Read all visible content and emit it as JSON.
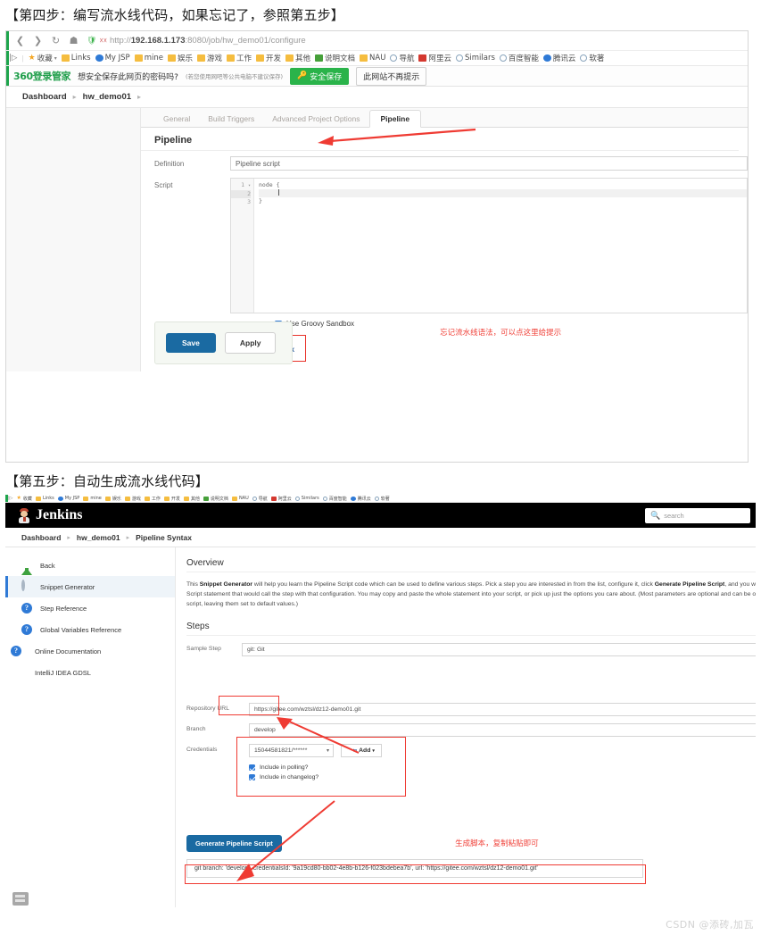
{
  "steps": {
    "step4_heading": "【第四步：编写流水线代码，如果忘记了，参照第五步】",
    "step5_heading": "【第五步：自动生成流水线代码】"
  },
  "browser": {
    "back_icon": "chevron-left-icon",
    "forward_icon": "chevron-right-icon",
    "reload_icon": "reload-icon",
    "home_icon": "home-icon",
    "url_host": "192.168.1.173",
    "url_rest": "http://192.168.1.173:8080/job/hw_demo01/configure",
    "url_prefix": "http://",
    "url_suffix": ":8080/job/hw_demo01/configure",
    "bookmarks": [
      "收藏",
      "Links",
      "My JSP",
      "mine",
      "娱乐",
      "游戏",
      "工作",
      "开发",
      "其他",
      "说明文档",
      "NAU",
      "导航",
      "阿里云",
      "Similars",
      "百度智能",
      "腾讯云",
      "软著"
    ],
    "password_bar": {
      "brand": "360登录管家",
      "question": "想安全保存此网页的密码吗?",
      "hint": "(若您使用网吧等公共电脑不建议保存)",
      "save_label": "安全保存",
      "never_label": "此网站不再提示",
      "key_icon": "key-icon"
    }
  },
  "configure": {
    "breadcrumb": [
      "Dashboard",
      "hw_demo01"
    ],
    "tabs": [
      "General",
      "Build Triggers",
      "Advanced Project Options",
      "Pipeline"
    ],
    "active_tab": "Pipeline",
    "section_title": "Pipeline",
    "definition_label": "Definition",
    "definition_value": "Pipeline script",
    "script_label": "Script",
    "code_lines": [
      "node {",
      "",
      "}"
    ],
    "line_numbers": [
      "1",
      "2",
      "3"
    ],
    "fold_marker": "▾",
    "sandbox_label": "Use Groovy Sandbox",
    "sandbox_checked": true,
    "pipeline_syntax_link": "Pipeline Syntax",
    "annotation": "忘记流水线语法，可以点这里给提示",
    "save_label": "Save",
    "apply_label": "Apply"
  },
  "snippet": {
    "logo_text": "Jenkins",
    "search_placeholder": "search",
    "search_icon": "search-icon",
    "breadcrumb": [
      "Dashboard",
      "hw_demo01",
      "Pipeline Syntax"
    ],
    "sidebar": [
      {
        "label": "Back",
        "icon": "up-arrow-icon"
      },
      {
        "label": "Snippet Generator",
        "icon": "gear-icon"
      },
      {
        "label": "Step Reference",
        "icon": "help-icon"
      },
      {
        "label": "Global Variables Reference",
        "icon": "help-icon"
      },
      {
        "label": "Online Documentation",
        "icon": "help-icon"
      },
      {
        "label": "IntelliJ IDEA GDSL",
        "icon": "package-icon"
      }
    ],
    "active_sidebar": "Snippet Generator",
    "overview_title": "Overview",
    "overview_text_1": "This ",
    "overview_bold_1": "Snippet Generator",
    "overview_text_2": " will help you learn the Pipeline Script code which can be used to define various steps. Pick a step you are interested in from the list, configure it, click ",
    "overview_bold_2": "Generate Pipeline Script",
    "overview_text_3": ", and you will see a Pipeline Script statement that would call the step with that configuration. You may copy and paste the whole statement into your script, or pick up just the options you care about. (Most parameters are optional and can be omitted in your script, leaving them set to default values.)",
    "steps_title": "Steps",
    "sample_step_label": "Sample Step",
    "sample_step_value": "git: Git",
    "repo_url_label": "Repository URL",
    "repo_url_value": "https://gitee.com/wztsl/dz12-demo01.git",
    "branch_label": "Branch",
    "branch_value": "develop",
    "credentials_label": "Credentials",
    "credentials_value": "15044581821/******",
    "add_button_label": "Add",
    "add_icon": "key-add-icon",
    "polling_label": "Include in polling?",
    "polling_checked": true,
    "changelog_label": "Include in changelog?",
    "changelog_checked": true,
    "generate_button": "Generate Pipeline Script",
    "generated_script": "git branch: 'develop', credentialsId: '9a19cd80-bb02-4e8b-b126-f023bdebea7b', url: 'https://gitee.com/wztsl/dz12-demo01.git'",
    "annotation": "生成脚本，复制粘贴即可",
    "panel_icon": "panel-list-icon"
  },
  "watermark": "CSDN @添砖,加瓦",
  "colors": {
    "accent_blue": "#1a6aa2",
    "annotation_red": "#ef3b33",
    "link_blue": "#2f5f9e",
    "checkbox_blue": "#2f7ad6",
    "save_green": "#2ab34a"
  }
}
